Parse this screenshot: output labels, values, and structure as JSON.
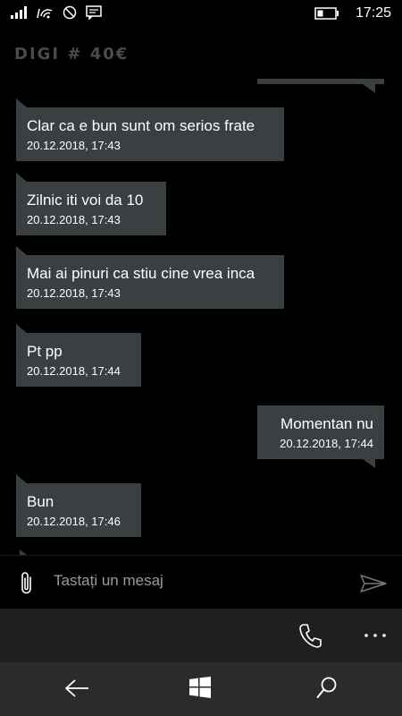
{
  "status_bar": {
    "time": "17:25",
    "icons": [
      "signal-icon",
      "wifi-calling-icon",
      "do-not-disturb-icon",
      "message-notification-icon",
      "battery-icon"
    ]
  },
  "header": {
    "title": "DIGI # 40€"
  },
  "messages": [
    {
      "direction": "incoming",
      "text": "Clar ca e bun sunt om serios frate",
      "timestamp": "20.12.2018, 17:43"
    },
    {
      "direction": "incoming",
      "text": "Zilnic iti voi da 10",
      "timestamp": "20.12.2018, 17:43"
    },
    {
      "direction": "incoming",
      "text": "Mai ai pinuri ca stiu cine vrea inca",
      "timestamp": "20.12.2018, 17:43"
    },
    {
      "direction": "incoming",
      "text": "Pt pp",
      "timestamp": "20.12.2018, 17:44"
    },
    {
      "direction": "outgoing",
      "text": "Momentan nu",
      "timestamp": "20.12.2018, 17:44"
    },
    {
      "direction": "incoming",
      "text": "Bun",
      "timestamp": "20.12.2018, 17:46"
    }
  ],
  "compose": {
    "placeholder": "Tastați un mesaj"
  },
  "app_bar": {
    "icons": [
      "phone-icon",
      "more-icon"
    ]
  },
  "nav_bar": {
    "icons": [
      "back-icon",
      "windows-icon",
      "search-icon"
    ]
  },
  "colors": {
    "bubble": "#3a3f42",
    "background": "#000000",
    "title": "#4b4b4b"
  }
}
